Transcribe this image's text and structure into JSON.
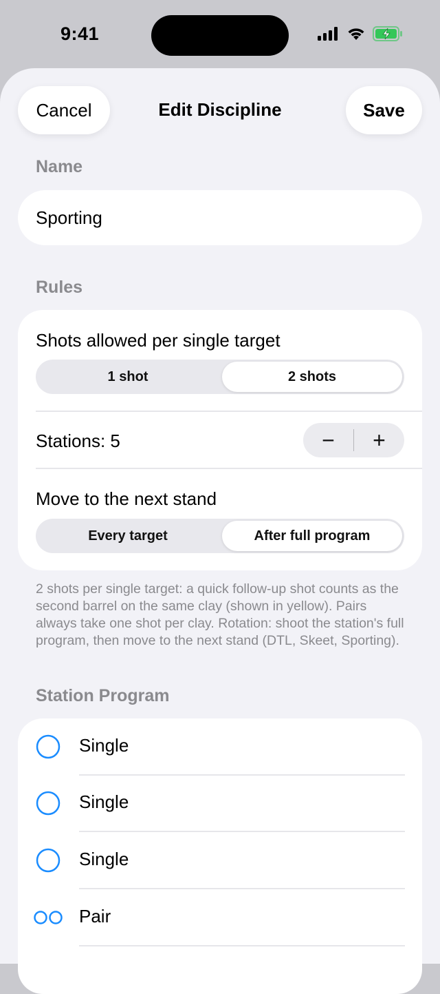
{
  "status_bar": {
    "time": "9:41",
    "icons": [
      "signal-icon",
      "wifi-icon",
      "battery-charging-icon"
    ]
  },
  "nav": {
    "cancel_label": "Cancel",
    "title": "Edit Discipline",
    "save_label": "Save"
  },
  "name_section": {
    "label": "Name",
    "value": "Sporting"
  },
  "rules_section": {
    "label": "Rules",
    "shots_label": "Shots allowed per single target",
    "shots_options": [
      "1 shot",
      "2 shots"
    ],
    "shots_selected": "2 shots",
    "stations_label": "Stations: 5",
    "stepper_minus": "−",
    "stepper_plus": "+",
    "move_label": "Move to the next stand",
    "move_options": [
      "Every target",
      "After full program"
    ],
    "move_selected": "After full program",
    "footer": "2 shots per single target: a quick follow-up shot counts as the second barrel on the same clay (shown in yellow). Pairs always take one shot per clay. Rotation: shoot the station's full program, then move to the next stand (DTL, Skeet, Sporting)."
  },
  "program_section": {
    "label": "Station Program",
    "items": [
      {
        "label": "Single",
        "icon": "single-circle-icon"
      },
      {
        "label": "Single",
        "icon": "single-circle-icon"
      },
      {
        "label": "Single",
        "icon": "single-circle-icon"
      },
      {
        "label": "Pair",
        "icon": "pair-circles-icon"
      }
    ]
  },
  "colors": {
    "accent": "#1a8cff",
    "battery": "#34c759",
    "background": "#f2f2f7"
  }
}
